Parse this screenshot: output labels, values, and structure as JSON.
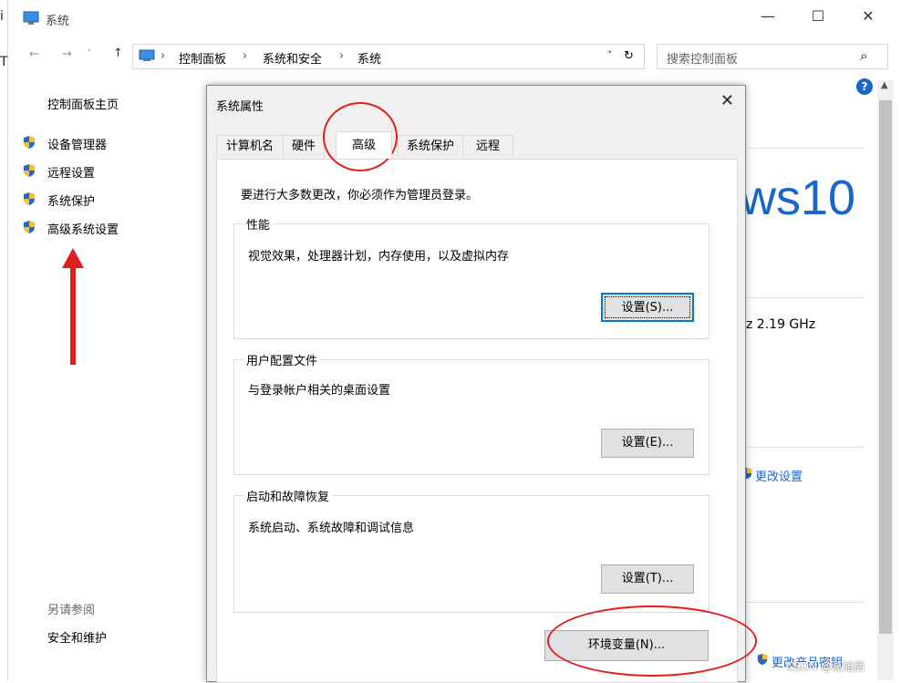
{
  "window": {
    "title": "系统",
    "edge_chars": [
      "i",
      "T"
    ],
    "controls": {
      "minimize": "—",
      "maximize": "☐",
      "close": "✕"
    }
  },
  "address_bar": {
    "back": "←",
    "forward": "→",
    "recent": "˅",
    "up": "↑",
    "crumbs": [
      "控制面板",
      "系统和安全",
      "系统"
    ],
    "dropdown": "˅",
    "refresh": "↻",
    "search_placeholder": "搜索控制面板",
    "search_icon": "⌕"
  },
  "sidebar": {
    "home": "控制面板主页",
    "items": [
      {
        "label": "设备管理器",
        "icon": "shield-icon"
      },
      {
        "label": "远程设置",
        "icon": "shield-icon"
      },
      {
        "label": "系统保护",
        "icon": "shield-icon"
      },
      {
        "label": "高级系统设置",
        "icon": "shield-icon"
      }
    ],
    "see_also": "另请参阅",
    "security": "安全和维护"
  },
  "background_content": {
    "logo_text": "ws10",
    "cpu_speed": "z  2.19 GHz",
    "change_settings": "更改设置",
    "change_key": "更改产品密钥",
    "watermark": "CSDN @葛旭朋",
    "help": "?"
  },
  "dialog": {
    "title": "系统属性",
    "close": "✕",
    "tabs": [
      "计算机名",
      "硬件",
      "高级",
      "系统保护",
      "远程"
    ],
    "active_tab": "高级",
    "intro": "要进行大多数更改，你必须作为管理员登录。",
    "groups": [
      {
        "legend": "性能",
        "desc": "视觉效果，处理器计划，内存使用，以及虚拟内存",
        "button": "设置(S)..."
      },
      {
        "legend": "用户配置文件",
        "desc": "与登录帐户相关的桌面设置",
        "button": "设置(E)..."
      },
      {
        "legend": "启动和故障恢复",
        "desc": "系统启动、系统故障和调试信息",
        "button": "设置(T)..."
      }
    ],
    "env_button": "环境变量(N)..."
  },
  "colors": {
    "accent": "#0078d7",
    "annotation": "#e02020",
    "link_blue": "#1a66c9"
  }
}
